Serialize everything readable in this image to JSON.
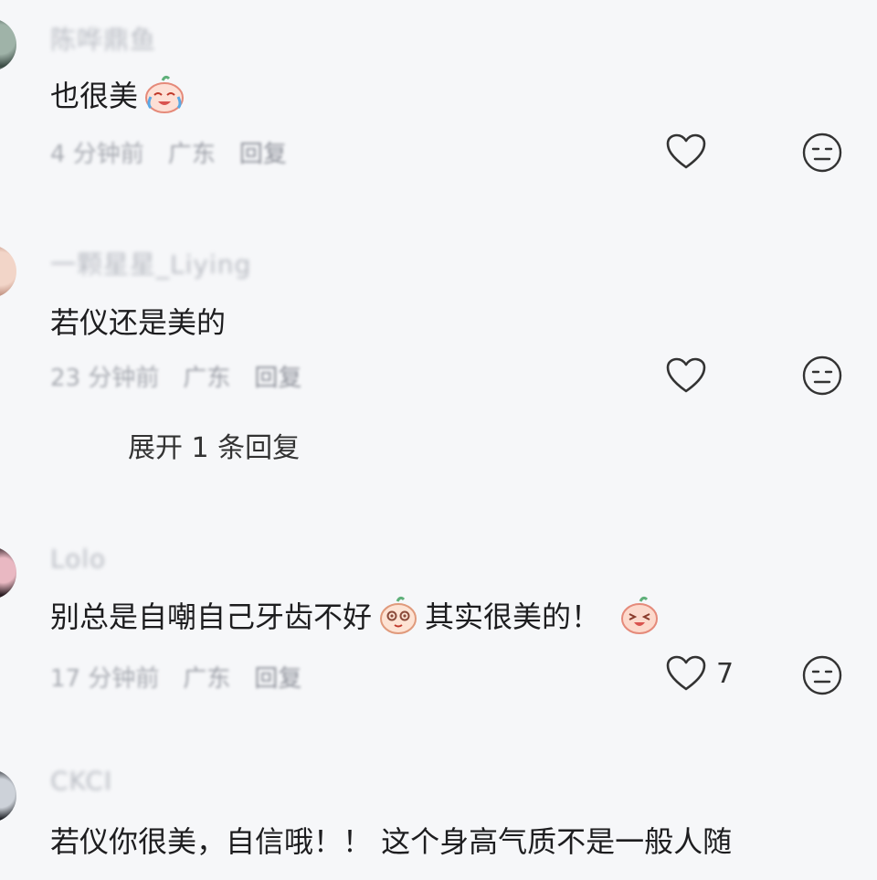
{
  "comments": [
    {
      "username": "陈哗鼎鱼",
      "text_before": "也很美",
      "text_after": "",
      "emoji": "crying-laughing-emoji",
      "time": "4 分钟前",
      "location": "广东",
      "reply": "回复",
      "like_count": ""
    },
    {
      "username": "一颗星星_Liying",
      "text_before": "若仪还是美的",
      "text_after": "",
      "time": "23 分钟前",
      "location": "广东",
      "reply": "回复",
      "like_count": ""
    },
    {
      "username": "Lolo",
      "text_before": "别总是自嘲自己牙齿不好",
      "text_after": "其实很美的！",
      "emoji": "shy-emoji",
      "emoji2": "wink-emoji",
      "time": "17 分钟前",
      "location": "广东",
      "reply": "回复",
      "like_count": "7"
    },
    {
      "username": "CKCI",
      "text_before": "若仪你很美，自信哦！！ 这个身高气质不是一般人随",
      "text_after": "",
      "time": "",
      "location": "",
      "reply": "",
      "like_count": ""
    }
  ],
  "expand_replies": "展开 1 条回复",
  "icons": {
    "like": "heart-outline-icon",
    "dislike": "meh-face-icon"
  }
}
